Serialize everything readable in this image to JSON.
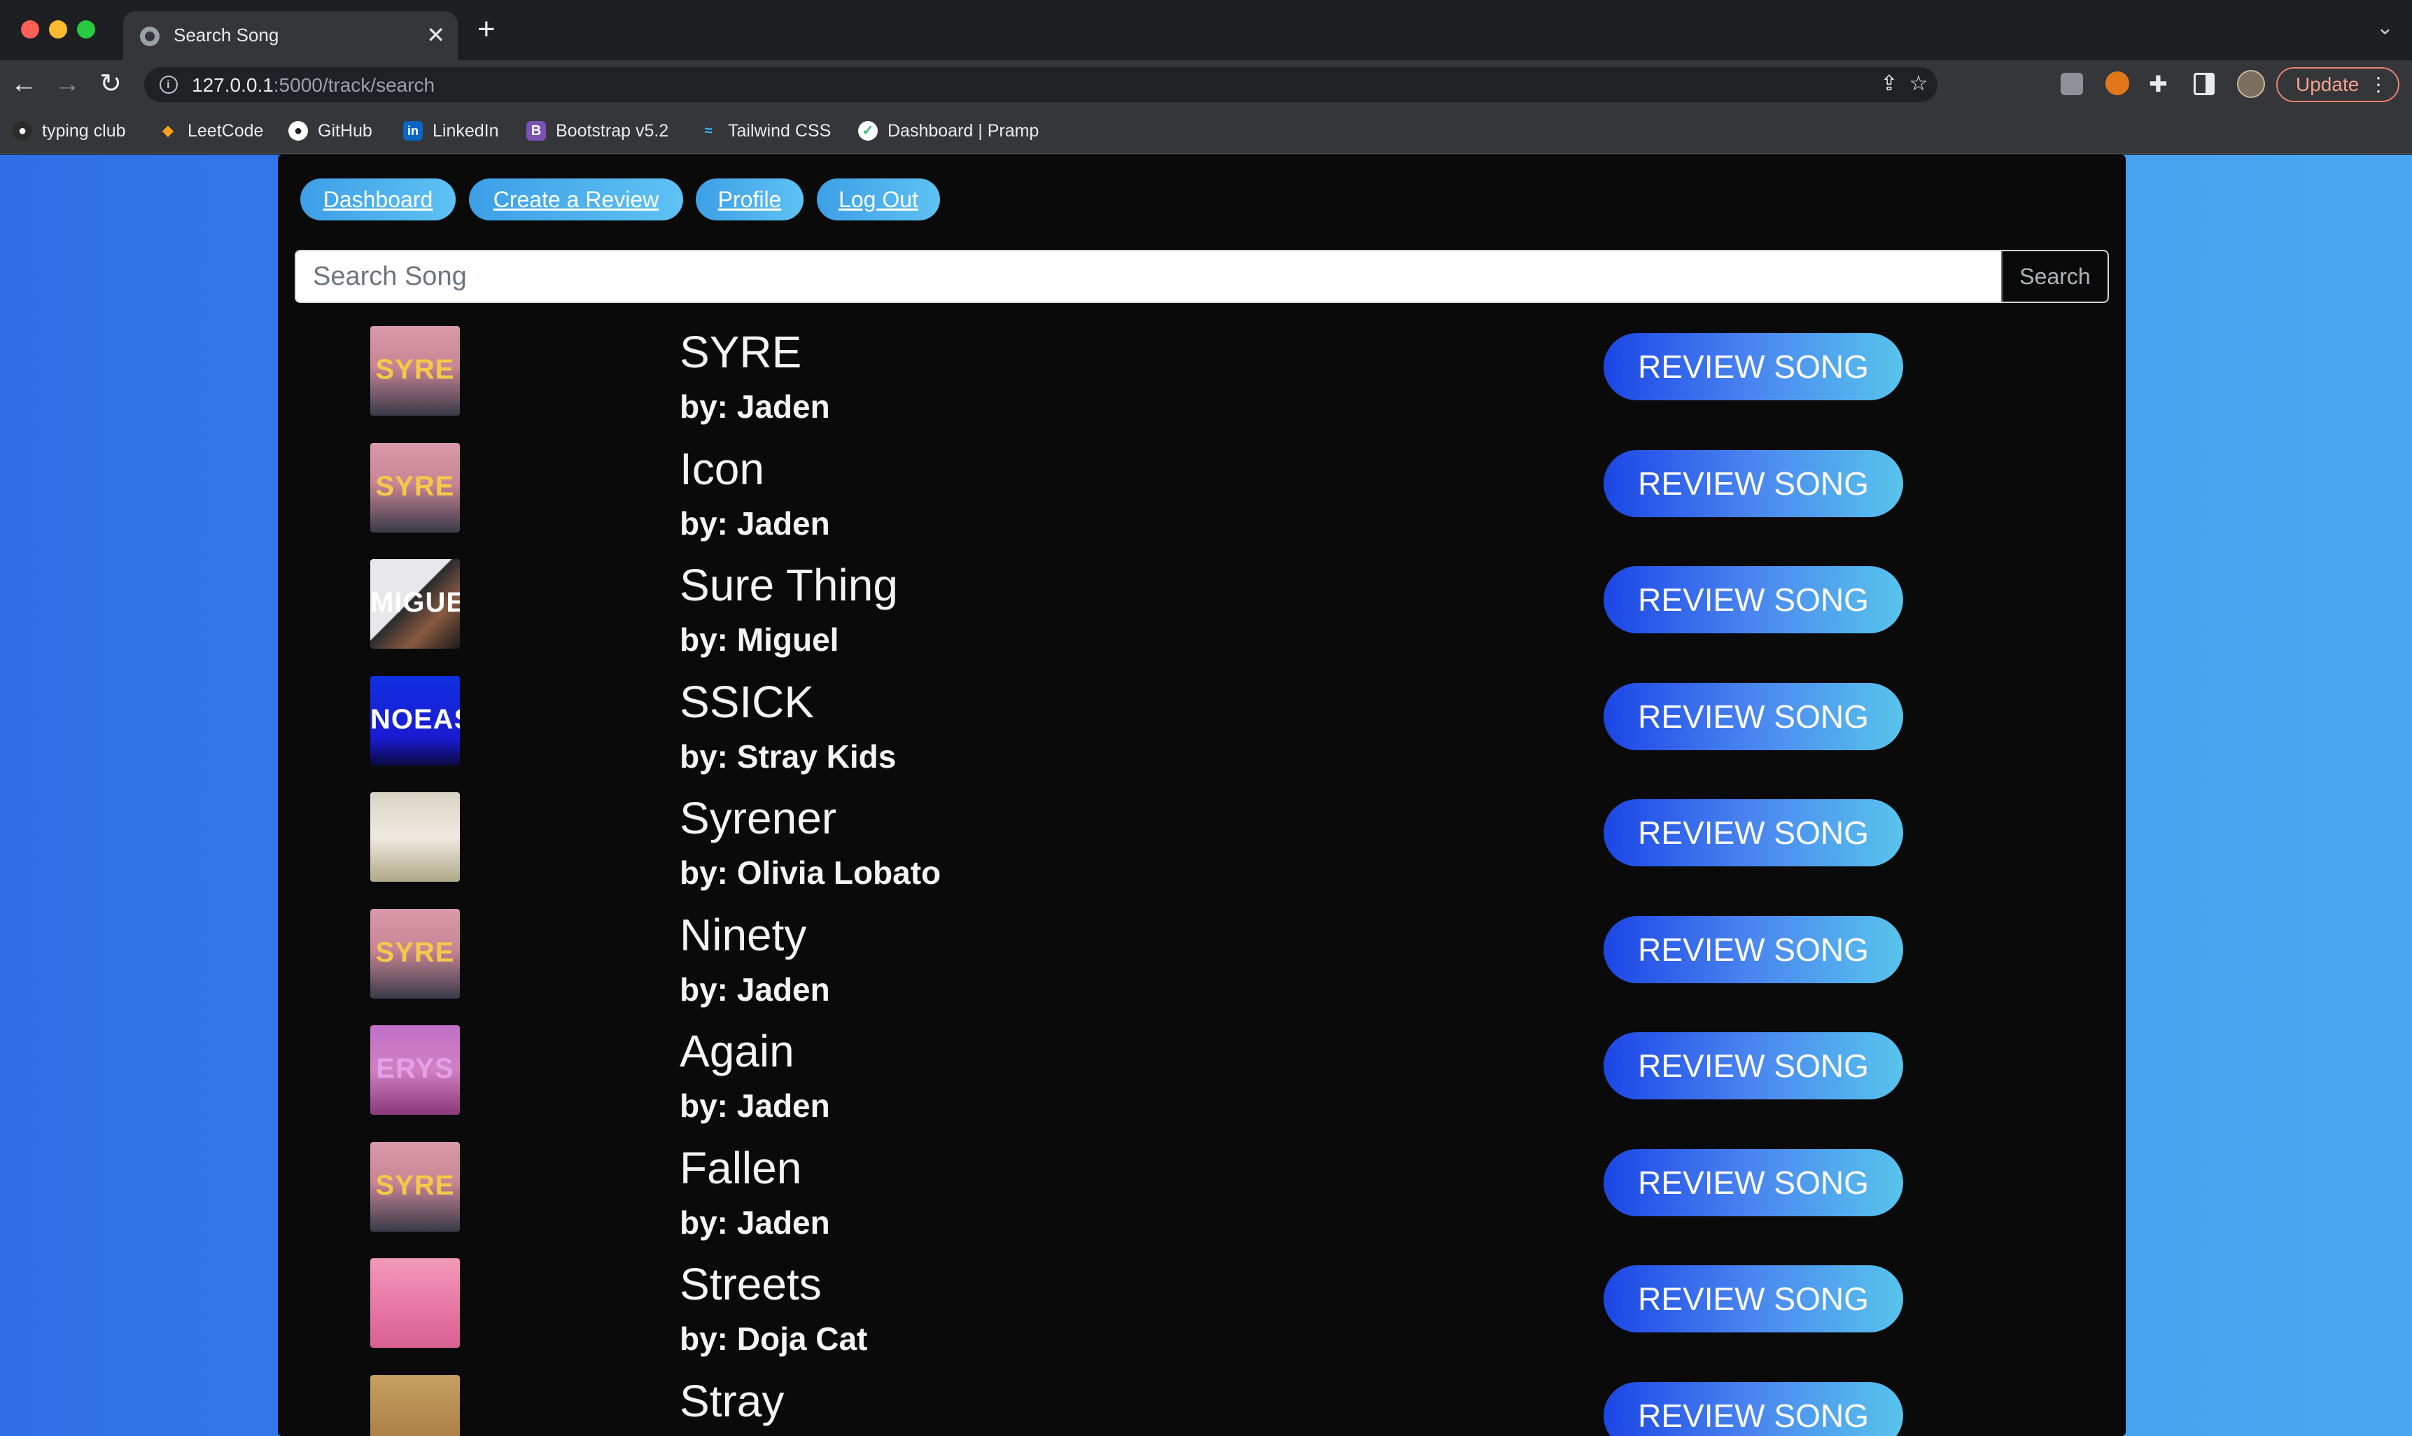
{
  "browser": {
    "tab_title": "Search Song",
    "url_host": "127.0.0.1",
    "url_path": ":5000/track/search",
    "update_label": "Update",
    "bookmarks": [
      {
        "label": "typing club",
        "icon": "ninja-icon",
        "color": "#2b2b2b"
      },
      {
        "label": "LeetCode",
        "icon": "leetcode-icon",
        "color": "#ffa116"
      },
      {
        "label": "GitHub",
        "icon": "github-icon",
        "color": "#ffffff"
      },
      {
        "label": "LinkedIn",
        "icon": "linkedin-icon",
        "color": "#0a66c2"
      },
      {
        "label": "Bootstrap v5.2",
        "icon": "bootstrap-icon",
        "color": "#7952b3"
      },
      {
        "label": "Tailwind CSS",
        "icon": "tailwind-icon",
        "color": "#38bdf8"
      },
      {
        "label": "Dashboard | Pramp",
        "icon": "pramp-icon",
        "color": "#5cc8a8"
      }
    ]
  },
  "nav": {
    "dashboard": "Dashboard",
    "create_review": "Create a Review",
    "profile": "Profile",
    "logout": "Log Out"
  },
  "search": {
    "placeholder": "Search Song",
    "button": "Search"
  },
  "review_label": "REVIEW SONG",
  "tracks": [
    {
      "title": "SYRE",
      "artist": "by: Jaden",
      "cover": "SYRE",
      "cover_bg": "linear-gradient(180deg,#d99aa9 0%,#c88595 45%,#3a3a48 100%)",
      "cover_fg": "#f5c84a"
    },
    {
      "title": "Icon",
      "artist": "by: Jaden",
      "cover": "SYRE",
      "cover_bg": "linear-gradient(180deg,#d99aa9 0%,#c88595 45%,#3a3a48 100%)",
      "cover_fg": "#f5c84a"
    },
    {
      "title": "Sure Thing",
      "artist": "by: Miguel",
      "cover": "MIGUEL",
      "cover_bg": "linear-gradient(135deg,#e8e8ea 0%,#e8e8ea 45%,#2a2a2e 46%,#8a5a40 70%,#1a1a1a 100%)",
      "cover_fg": "#ffffff"
    },
    {
      "title": "SSICK",
      "artist": "by: Stray Kids",
      "cover": "NOEASY",
      "cover_bg": "linear-gradient(180deg,#1030e0 0%,#1a1ad0 70%,#0a0a40 100%)",
      "cover_fg": "#ffffff"
    },
    {
      "title": "Syrener",
      "artist": "by: Olivia Lobato",
      "cover": "",
      "cover_bg": "linear-gradient(180deg,#d8d4c4 0%,#eeeae0 50%,#b0a888 100%)",
      "cover_fg": "#ffffff"
    },
    {
      "title": "Ninety",
      "artist": "by: Jaden",
      "cover": "SYRE",
      "cover_bg": "linear-gradient(180deg,#d99aa9 0%,#c88595 45%,#3a3a48 100%)",
      "cover_fg": "#f5c84a"
    },
    {
      "title": "Again",
      "artist": "by: Jaden",
      "cover": "ERYS",
      "cover_bg": "linear-gradient(180deg,#c070c8 0%,#d080c0 50%,#8a3a7a 100%)",
      "cover_fg": "#e4a0e8"
    },
    {
      "title": "Fallen",
      "artist": "by: Jaden",
      "cover": "SYRE",
      "cover_bg": "linear-gradient(180deg,#d99aa9 0%,#c88595 45%,#3a3a48 100%)",
      "cover_fg": "#f5c84a"
    },
    {
      "title": "Streets",
      "artist": "by: Doja Cat",
      "cover": "",
      "cover_bg": "linear-gradient(180deg,#f29ab8 0%,#e87aa8 50%,#d86090 100%)",
      "cover_fg": "#ffffff"
    },
    {
      "title": "Stray",
      "artist": "",
      "cover": "",
      "cover_bg": "linear-gradient(180deg,#c8a060 0%,#a07040 100%)",
      "cover_fg": "#ffffff"
    }
  ]
}
